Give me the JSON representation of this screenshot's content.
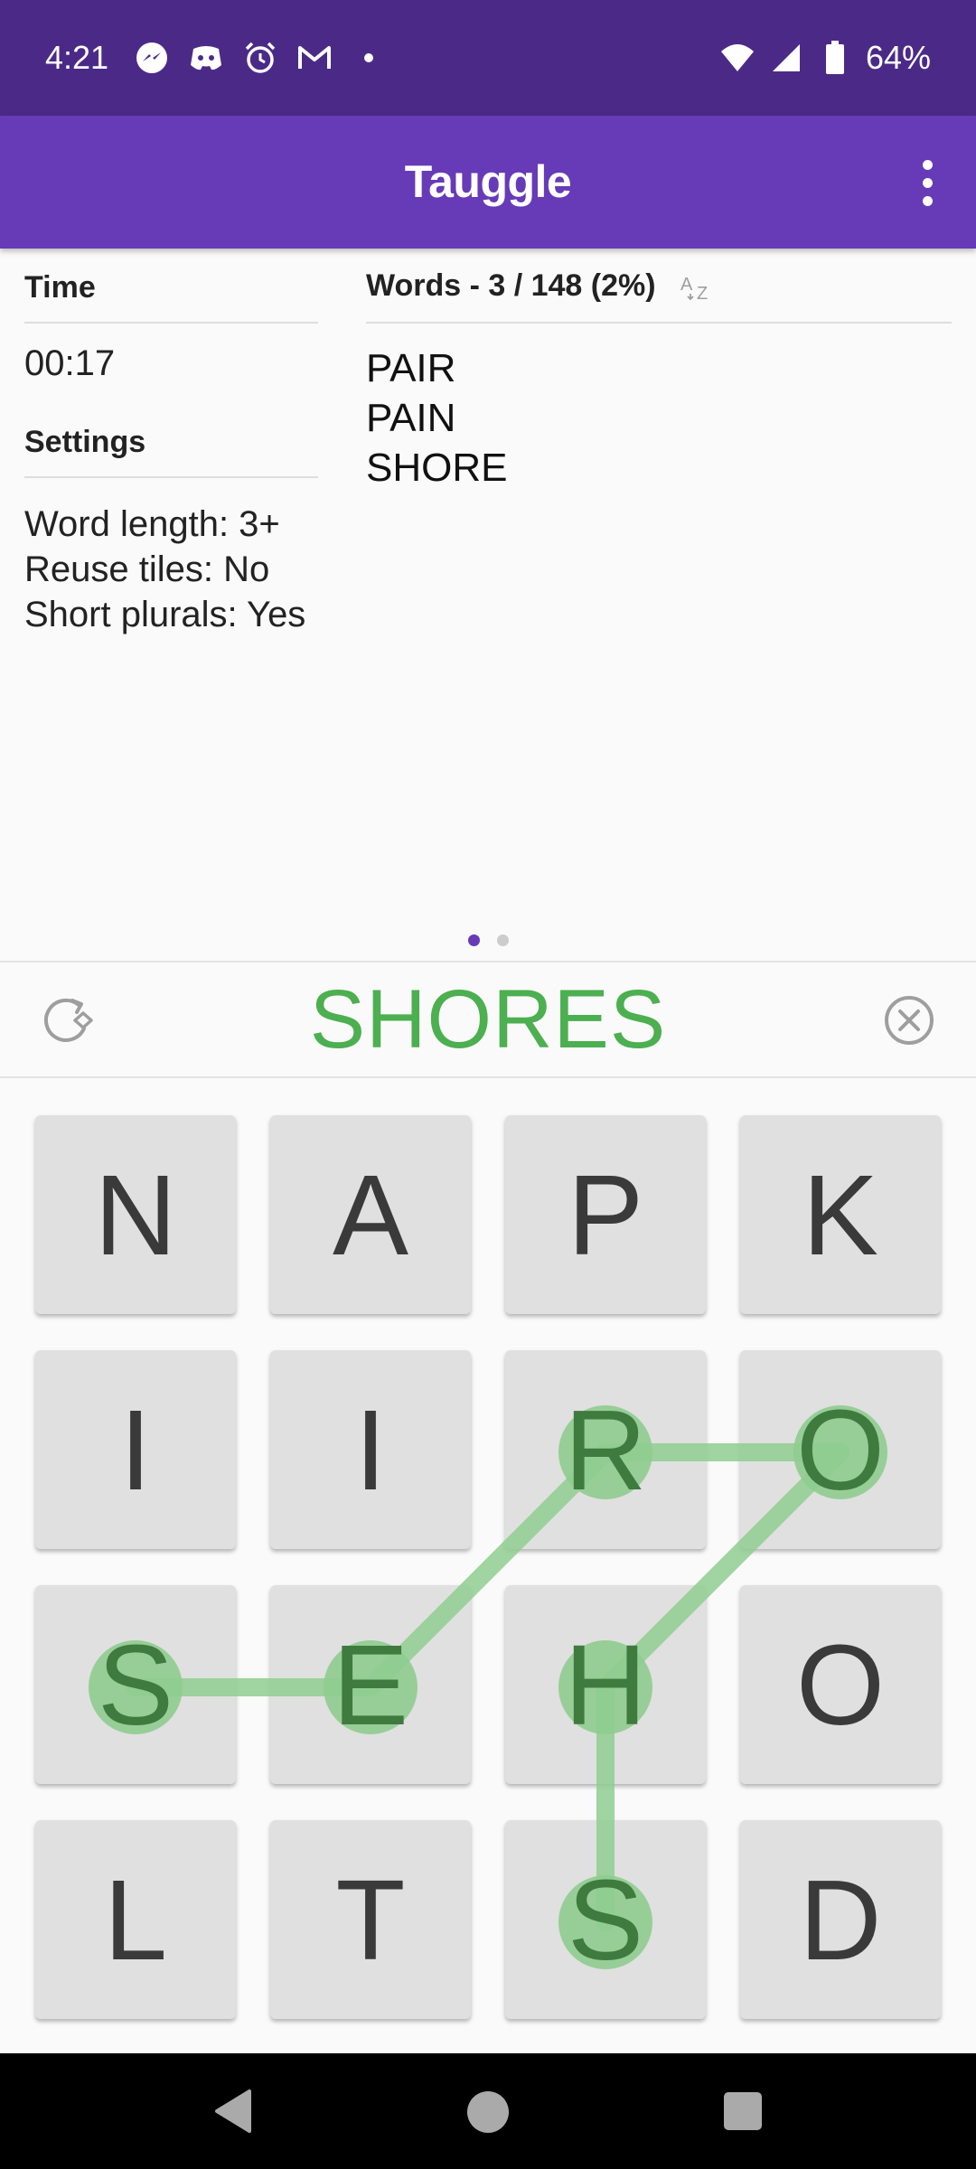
{
  "status_bar": {
    "time": "4:21",
    "battery": "64%",
    "icons": [
      "messenger-icon",
      "discord-icon",
      "alarm-icon",
      "gmail-icon",
      "dot-icon",
      "wifi-icon",
      "signal-icon",
      "battery-icon"
    ]
  },
  "app_bar": {
    "title": "Tauggle",
    "menu_icon": "more-vert-icon"
  },
  "left_panel": {
    "time_label": "Time",
    "time_value": "00:17",
    "settings_label": "Settings",
    "settings": [
      "Word length: 3+",
      "Reuse tiles: No",
      "Short plurals: Yes"
    ]
  },
  "right_panel": {
    "words_title": "Words - 3 / 148 (2%)",
    "sort_icon": "sort-alpha-icon",
    "words": [
      "PAIR",
      "PAIN",
      "SHORE"
    ]
  },
  "pager": {
    "page_count": 2,
    "active_page": 1
  },
  "word_bar": {
    "current_word": "SHORES",
    "rotate_icon": "rotate-board-icon",
    "clear_icon": "clear-circle-icon"
  },
  "grid": {
    "rows": [
      [
        "N",
        "A",
        "P",
        "K"
      ],
      [
        "I",
        "I",
        "R",
        "O"
      ],
      [
        "S",
        "E",
        "H",
        "O"
      ],
      [
        "L",
        "T",
        "S",
        "D"
      ]
    ],
    "selected_path": [
      [
        2,
        0
      ],
      [
        2,
        1
      ],
      [
        1,
        2
      ],
      [
        1,
        3
      ],
      [
        2,
        2
      ],
      [
        3,
        2
      ]
    ],
    "colors": {
      "tile": "#e0e0e0",
      "letter": "#3a3a3a",
      "path": "#8fcc8f",
      "path_letter": "#3f7a3f"
    }
  },
  "colors": {
    "status_bar": "#4b2a87",
    "app_bar": "#673ab7",
    "current_word": "#4caf50",
    "accent": "#673ab7"
  },
  "nav_bar": {
    "buttons": [
      "back-icon",
      "home-icon",
      "recents-icon"
    ]
  }
}
